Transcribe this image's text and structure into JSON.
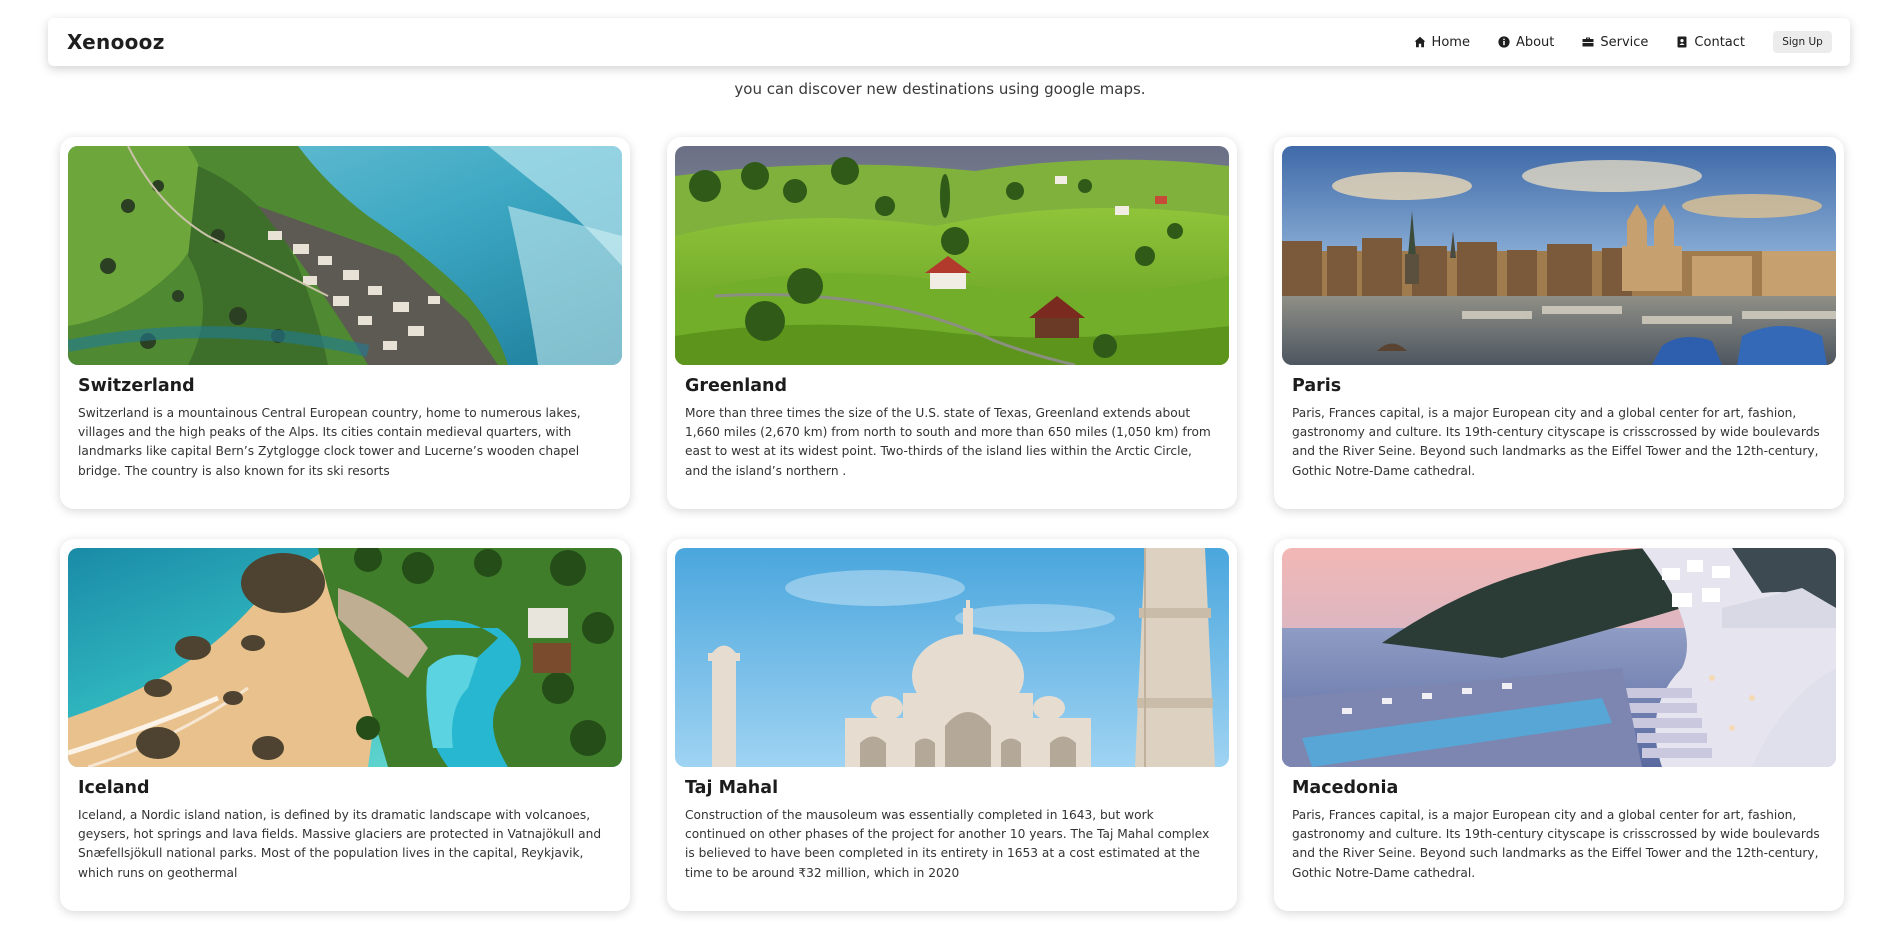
{
  "nav": {
    "brand": "Xenoooz",
    "links": [
      {
        "label": "Home",
        "icon": "home-icon"
      },
      {
        "label": "About",
        "icon": "info-icon"
      },
      {
        "label": "Service",
        "icon": "briefcase-icon"
      },
      {
        "label": "Contact",
        "icon": "contact-book-icon"
      }
    ],
    "signup": "Sign Up"
  },
  "subtitle": "you can discover new destinations using google maps.",
  "cards": [
    {
      "title": "Switzerland",
      "text": "Switzerland is a mountainous Central European country, home to numerous lakes, villages and the high peaks of the Alps. Its cities contain medieval quarters, with landmarks like capital Bern’s Zytglogge clock tower and Lucerne’s wooden chapel bridge. The country is also known for its ski resorts"
    },
    {
      "title": "Greenland",
      "text": "More than three times the size of the U.S. state of Texas, Greenland extends about 1,660 miles (2,670 km) from north to south and more than 650 miles (1,050 km) from east to west at its widest point. Two-thirds of the island lies within the Arctic Circle, and the island’s northern ."
    },
    {
      "title": "Paris",
      "text": "Paris, Frances capital, is a major European city and a global center for art, fashion, gastronomy and culture. Its 19th-century cityscape is crisscrossed by wide boulevards and the River Seine. Beyond such landmarks as the Eiffel Tower and the 12th-century, Gothic Notre-Dame cathedral."
    },
    {
      "title": "Iceland",
      "text": "Iceland, a Nordic island nation, is defined by its dramatic landscape with volcanoes, geysers, hot springs and lava fields. Massive glaciers are protected in Vatnajökull and Snæfellsjökull national parks. Most of the population lives in the capital, Reykjavik, which runs on geothermal"
    },
    {
      "title": "Taj Mahal",
      "text": "Construction of the mausoleum was essentially completed in 1643, but work continued on other phases of the project for another 10 years. The Taj Mahal complex is believed to have been completed in its entirety in 1653 at a cost estimated at the time to be around ₹32 million, which in 2020"
    },
    {
      "title": "Macedonia",
      "text": "Paris, Frances capital, is a major European city and a global center for art, fashion, gastronomy and culture. Its 19th-century cityscape is crisscrossed by wide boulevards and the River Seine. Beyond such landmarks as the Eiffel Tower and the 12th-century, Gothic Notre-Dame cathedral."
    }
  ]
}
